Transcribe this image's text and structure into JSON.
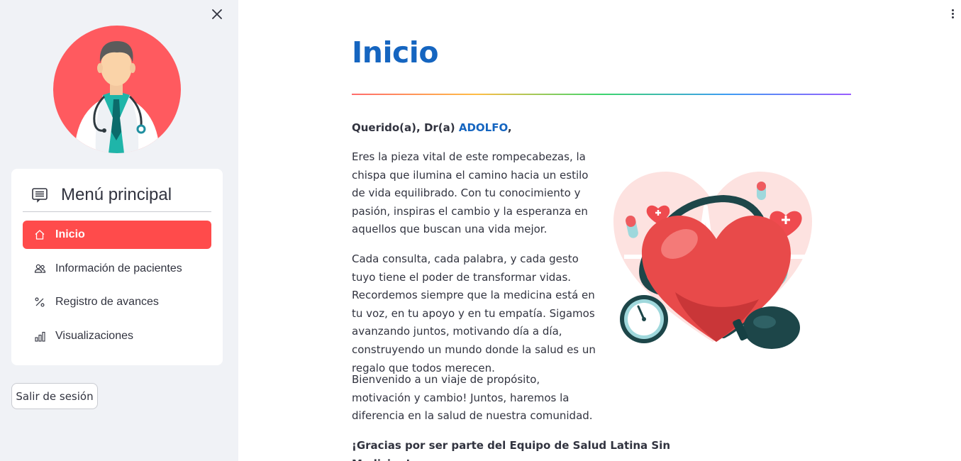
{
  "sidebar": {
    "menu_title": "Menú principal",
    "items": [
      {
        "label": "Inicio",
        "icon": "house-icon",
        "active": true
      },
      {
        "label": "Información de pacientes",
        "icon": "people-icon",
        "active": false
      },
      {
        "label": "Registro de avances",
        "icon": "percent-icon",
        "active": false
      },
      {
        "label": "Visualizaciones",
        "icon": "bar-chart-icon",
        "active": false
      }
    ],
    "logout_label": "Salir de sesión"
  },
  "main": {
    "title": "Inicio",
    "greeting_prefix": "Querido(a), Dr(a) ",
    "doctor_name": "ADOLFO",
    "greeting_suffix": ",",
    "paragraphs": [
      "Eres la pieza vital de este rompecabezas, la chispa que ilumina el camino hacia un estilo de vida equilibrado. Con tu conocimiento y pasión, inspiras el cambio y la esperanza en aquellos que buscan una vida mejor.",
      "Cada consulta, cada palabra, y cada gesto tuyo tiene el poder de transformar vidas. Recordemos siempre que la medicina está en tu voz, en tu apoyo y en tu empatía. Sigamos avanzando juntos, motivando día a día, construyendo un mundo donde la salud es un regalo que todos merecen.",
      "Bienvenido a un viaje de propósito, motivación y cambio! Juntos, haremos la diferencia en la salud de nuestra comunidad."
    ],
    "closing": "¡Gracias por ser parte del Equipo de Salud Latina Sin Medicina!"
  },
  "colors": {
    "accent": "#ff4b4b",
    "title_blue": "#1565c0",
    "sidebar_bg": "#f0f2f6"
  }
}
